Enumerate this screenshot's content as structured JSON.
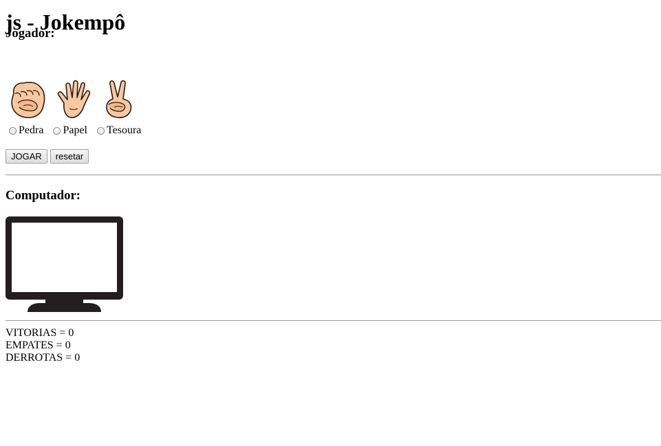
{
  "title": "js - Jokempô",
  "player": {
    "heading": "Jogador:",
    "hands": [
      {
        "icon": "rock-hand-icon"
      },
      {
        "icon": "paper-hand-icon"
      },
      {
        "icon": "scissors-hand-icon"
      }
    ],
    "options": [
      {
        "label": "Pedra",
        "selected": false
      },
      {
        "label": "Papel",
        "selected": false
      },
      {
        "label": "Tesoura",
        "selected": false
      }
    ]
  },
  "buttons": {
    "play_label": "JOGAR",
    "reset_label": "resetar"
  },
  "computer": {
    "heading": "Computador:",
    "icon": "monitor-icon"
  },
  "stats": {
    "wins_label": "VITORIAS",
    "wins_value": "0",
    "draws_label": "EMPATES",
    "draws_value": "0",
    "losses_label": "DERROTAS",
    "losses_value": "0"
  },
  "colors": {
    "skin": "#f7c9a1",
    "outline": "#2a1a12",
    "monitor": "#231f20"
  }
}
